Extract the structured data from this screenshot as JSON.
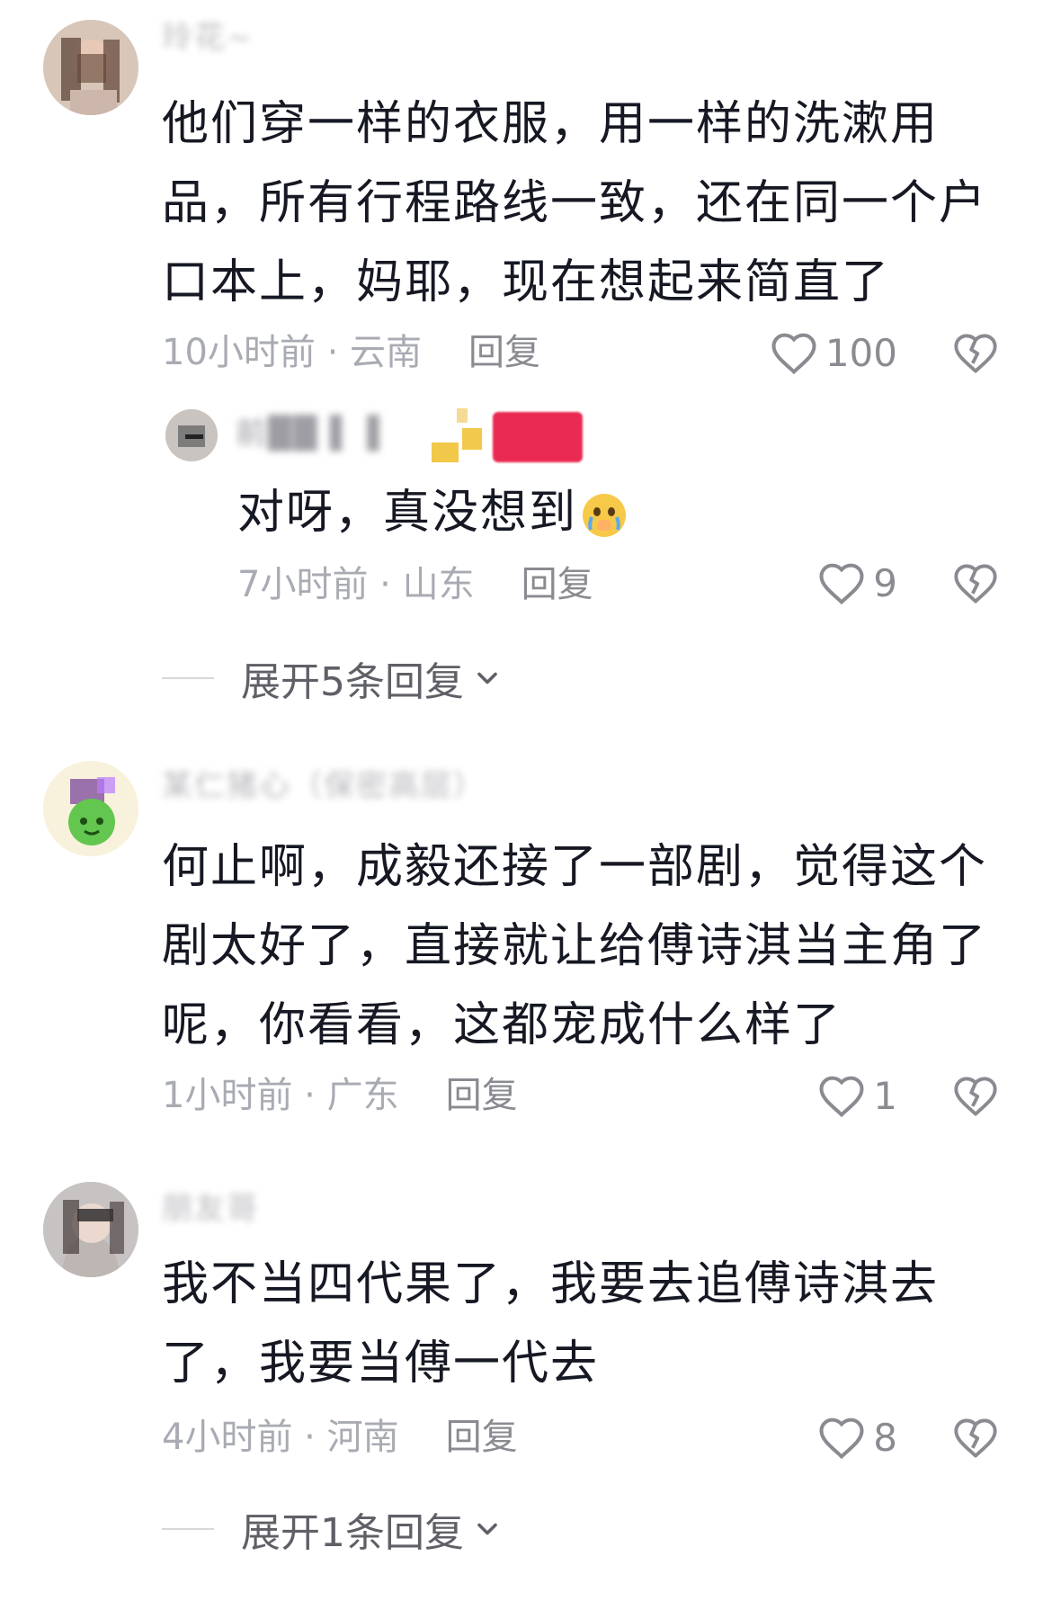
{
  "comments": [
    {
      "username": "玲花~",
      "text": "他们穿一样的衣服，用一样的洗漱用品，所有行程路线一致，还在同一个户口本上，妈耶，现在想起来简直了",
      "time_location": "10小时前 · 云南",
      "reply_label": "回复",
      "likes": "100",
      "replies": [
        {
          "username": "前██ ▌▐",
          "text": "对呀，真没想到",
          "time_location": "7小时前 · 山东",
          "reply_label": "回复",
          "likes": "9"
        }
      ],
      "expand_label": "展开5条回复"
    },
    {
      "username": "某仁猪心（保密高层）",
      "text": "何止啊，成毅还接了一部剧，觉得这个剧太好了，直接就让给傅诗淇当主角了呢，你看看，这都宠成什么样了",
      "time_location": "1小时前 · 广东",
      "reply_label": "回复",
      "likes": "1"
    },
    {
      "username": "朋友哥",
      "text": "我不当四代果了，我要去追傅诗淇去了，我要当傅一代去",
      "time_location": "4小时前 · 河南",
      "reply_label": "回复",
      "likes": "8",
      "expand_label": "展开1条回复"
    }
  ],
  "colors": {
    "badge": "#ea2a52",
    "text_primary": "#161823",
    "text_secondary": "#a9abb3"
  },
  "icons": [
    "heart-icon",
    "dislike-heart-icon",
    "chevron-down-icon",
    "crying-emoji-icon"
  ]
}
